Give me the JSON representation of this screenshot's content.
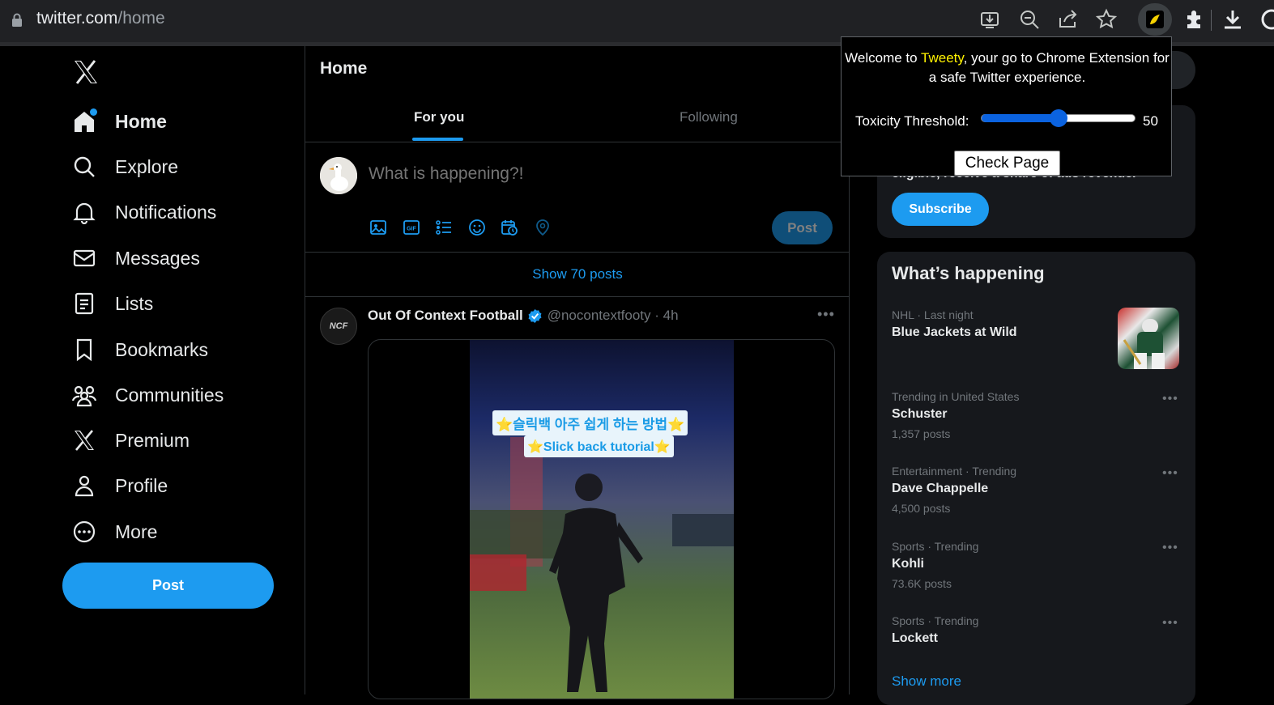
{
  "browser": {
    "url_host": "twitter.com",
    "url_path": "/home"
  },
  "nav": {
    "items": [
      {
        "label": "Home",
        "icon": "home-icon"
      },
      {
        "label": "Explore",
        "icon": "search-icon"
      },
      {
        "label": "Notifications",
        "icon": "bell-icon"
      },
      {
        "label": "Messages",
        "icon": "envelope-icon"
      },
      {
        "label": "Lists",
        "icon": "list-icon"
      },
      {
        "label": "Bookmarks",
        "icon": "bookmark-icon"
      },
      {
        "label": "Communities",
        "icon": "people-icon"
      },
      {
        "label": "Premium",
        "icon": "x-logo-icon"
      },
      {
        "label": "Profile",
        "icon": "person-icon"
      },
      {
        "label": "More",
        "icon": "more-circle-icon"
      }
    ],
    "post_button": "Post"
  },
  "main": {
    "title": "Home",
    "tabs": {
      "for_you": "For you",
      "following": "Following"
    },
    "compose": {
      "placeholder": "What is happening?!",
      "post_button": "Post"
    },
    "show_posts": "Show 70 posts",
    "tweet": {
      "avatar_text": "NCF",
      "name": "Out Of Context Football",
      "handle_time": "@nocontextfooty · 4h",
      "media": {
        "caption_korean": "⭐슬릭백 아주 쉽게 하는 방법⭐",
        "caption_english": "⭐Slick back tutorial⭐"
      }
    }
  },
  "sidebar": {
    "premium": {
      "text": "eligible, receive a share of ads revenue.",
      "subscribe": "Subscribe"
    },
    "trends": {
      "title": "What’s happening",
      "items": [
        {
          "meta": "NHL · Last night",
          "name": "Blue Jackets at Wild",
          "count": ""
        },
        {
          "meta": "Trending in United States",
          "name": "Schuster",
          "count": "1,357 posts"
        },
        {
          "meta": "Entertainment · Trending",
          "name": "Dave Chappelle",
          "count": "4,500 posts"
        },
        {
          "meta": "Sports · Trending",
          "name": "Kohli",
          "count": "73.6K posts"
        },
        {
          "meta": "Sports · Trending",
          "name": "Lockett",
          "count": ""
        }
      ],
      "show_more": "Show more"
    }
  },
  "extension_popup": {
    "welcome_before": "Welcome to ",
    "brand": "Tweety",
    "welcome_after": ", your go to Chrome Extension for a safe Twitter experience.",
    "threshold_label": "Toxicity Threshold:",
    "threshold_value": "50",
    "threshold_level": 0.5,
    "check_button": "Check Page"
  },
  "colors": {
    "accent": "#1d9bf0",
    "background": "#000000",
    "brand_yellow": "#fff200"
  }
}
